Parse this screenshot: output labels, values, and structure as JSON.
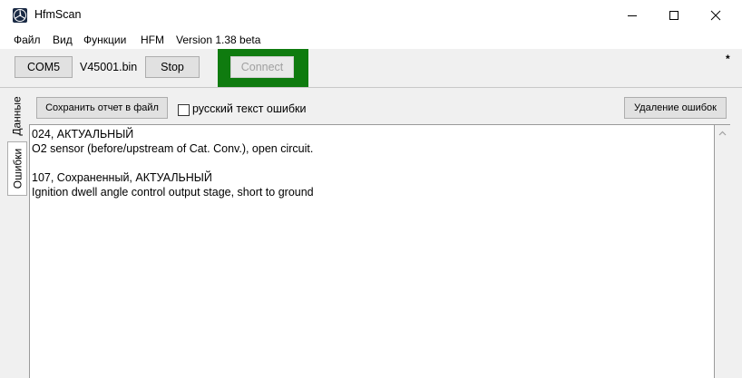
{
  "window": {
    "title": "HfmScan",
    "controls": {
      "minimize": "minimize",
      "maximize": "maximize",
      "close": "close"
    }
  },
  "menu": [
    "Файл",
    "Вид",
    "Функции",
    "HFM",
    "Version 1.38 beta"
  ],
  "toolbar": {
    "port_button": "COM5",
    "file_label": "V45001.bin",
    "stop_button": "Stop",
    "connect_button": "Connect",
    "connect_disabled": true,
    "highlight_color": "#0f7b0f",
    "status_mark": "*"
  },
  "side_tabs": [
    {
      "label": "Данные",
      "active": false
    },
    {
      "label": "Ошибки",
      "active": true
    }
  ],
  "errors_panel": {
    "save_report_button": "Сохранить отчет в файл",
    "russian_text_checkbox": {
      "label": "русский текст ошибки",
      "checked": false
    },
    "clear_errors_button": "Удаление ошибок",
    "lines": [
      "024,  АКТУАЛЬНЫЙ",
      "  O2 sensor (before/upstream of Cat. Conv.), open circuit.",
      "",
      "107,  Сохраненный,  АКТУАЛЬНЫЙ",
      " Ignition dwell angle control output stage, short to ground"
    ]
  }
}
